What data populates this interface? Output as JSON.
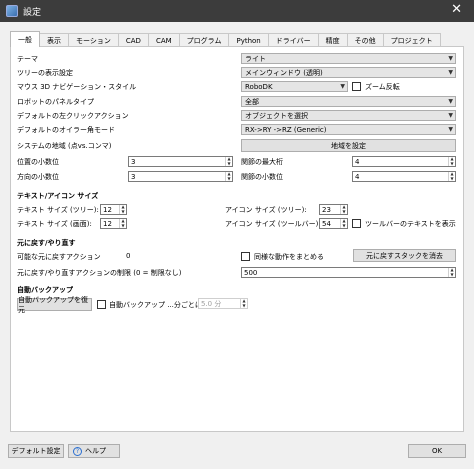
{
  "window": {
    "title": "設定",
    "close": "✕"
  },
  "tabs": [
    "一般",
    "表示",
    "モーション",
    "CAD",
    "CAM",
    "プログラム",
    "Python",
    "ドライバー",
    "精度",
    "その他",
    "プロジェクト"
  ],
  "general": {
    "theme_label": "テーマ",
    "theme_value": "ライト",
    "tree_label": "ツリーの表示設定",
    "tree_value": "メインウィンドウ (透明)",
    "mouse_label": "マウス 3D ナビゲーション・スタイル",
    "mouse_value": "RoboDK",
    "zoom_invert_label": "ズーム反転",
    "robot_panel_label": "ロボットのパネルタイプ",
    "robot_panel_value": "全部",
    "left_click_label": "デフォルトの左クリックアクション",
    "left_click_value": "オブジェクトを選択",
    "euler_label": "デフォルトのオイラー角モード",
    "euler_value": "RX->RY ->RZ  (Generic)",
    "locale_label": "システムの地域 (点vs.コンマ)",
    "locale_button": "地域を設定",
    "pos_decimals_label": "位置の小数位",
    "pos_decimals_value": "3",
    "dir_decimals_label": "方向の小数位",
    "dir_decimals_value": "3",
    "joint_max_digits_label": "関節の最大桁",
    "joint_max_digits_value": "4",
    "joint_decimals_label": "関節の小数位",
    "joint_decimals_value": "4"
  },
  "text_icon": {
    "title": "テキスト/アイコン サイズ",
    "text_tree_label": "テキスト サイズ (ツリー):",
    "text_tree_value": "12",
    "text_screen_label": "テキスト サイズ (画面):",
    "text_screen_value": "12",
    "icon_tree_label": "アイコン サイズ (ツリー):",
    "icon_tree_value": "23",
    "icon_toolbar_label": "アイコン サイズ (ツールバー):",
    "icon_toolbar_value": "54",
    "toolbar_text_label": "ツールバーのテキストを表示"
  },
  "undo": {
    "title": "元に戻す/やり直す",
    "available_label": "可能な元に戻すアクション",
    "available_value": "0",
    "group_label": "同様な動作をまとめる",
    "clear_button": "元に戻すスタックを消去",
    "limit_label": "元に戻す/やり直すアクションの制限 (0 = 制限なし)",
    "limit_value": "500"
  },
  "backup": {
    "title": "自動バックアップ",
    "restore_button": "自動バックアップを復元",
    "auto_label": "自動バックアップ ...分ごとに",
    "interval_value": "5.0 分"
  },
  "footer": {
    "default_button": "デフォルト設定",
    "help_button": "ヘルプ",
    "help_icon": "?",
    "ok_button": "OK"
  },
  "glyphs": {
    "arrow": "▼",
    "up": "▲",
    "down": "▼"
  }
}
